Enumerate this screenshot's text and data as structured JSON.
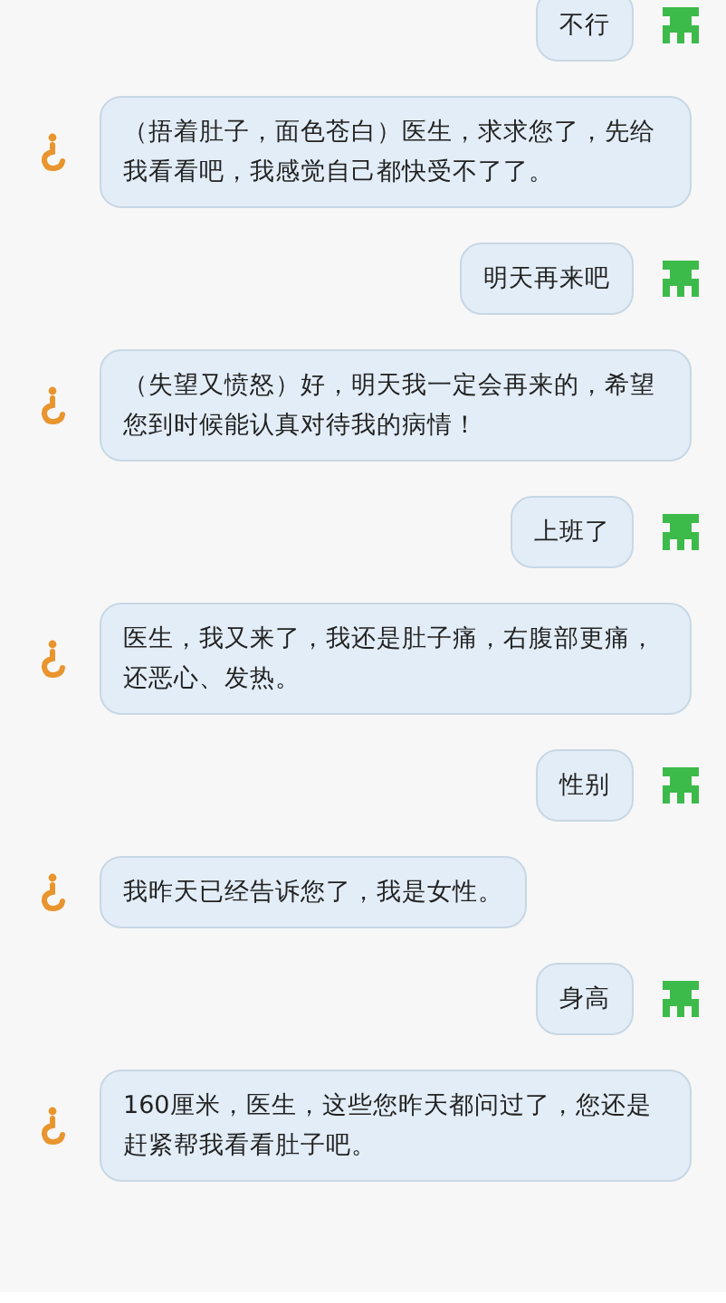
{
  "messages": [
    {
      "kind": "sent",
      "text": "不行"
    },
    {
      "kind": "received",
      "text": "（捂着肚子，面色苍白）医生，求求您了，先给我看看吧，我感觉自己都快受不了了。"
    },
    {
      "kind": "sent",
      "text": "明天再来吧"
    },
    {
      "kind": "received",
      "text": "（失望又愤怒）好，明天我一定会再来的，希望您到时候能认真对待我的病情！"
    },
    {
      "kind": "sent",
      "text": "上班了"
    },
    {
      "kind": "received",
      "text": "医生，我又来了，我还是肚子痛，右腹部更痛，还恶心、发热。"
    },
    {
      "kind": "sent",
      "text": "性别"
    },
    {
      "kind": "received",
      "text": "我昨天已经告诉您了，我是女性。"
    },
    {
      "kind": "sent",
      "text": "身高"
    },
    {
      "kind": "received",
      "text": "160厘米，医生，这些您昨天都问过了，您还是赶紧帮我看看肚子吧。"
    }
  ]
}
